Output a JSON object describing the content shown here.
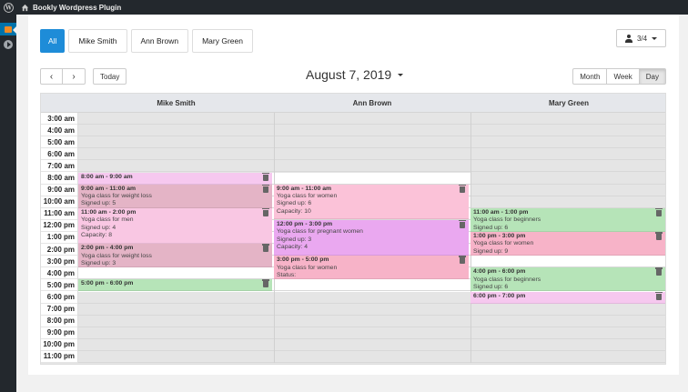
{
  "adminbar": {
    "site_title": "Bookly Wordpress Plugin",
    "wp_icon": "wordpress-logo-icon",
    "home_icon": "home-icon"
  },
  "staff_tabs": [
    {
      "label": "All",
      "active": true
    },
    {
      "label": "Mike Smith",
      "active": false
    },
    {
      "label": "Ann Brown",
      "active": false
    },
    {
      "label": "Mary Green",
      "active": false
    }
  ],
  "staff_selector": {
    "value": "3/4",
    "icon": "person-icon"
  },
  "toolbar": {
    "prev": "‹",
    "next": "›",
    "today": "Today",
    "date": "August 7, 2019"
  },
  "views": [
    {
      "label": "Month",
      "active": false
    },
    {
      "label": "Week",
      "active": false
    },
    {
      "label": "Day",
      "active": true
    }
  ],
  "columns": [
    "Mike Smith",
    "Ann Brown",
    "Mary Green"
  ],
  "times": [
    "3:00 am",
    "4:00 am",
    "5:00 am",
    "6:00 am",
    "7:00 am",
    "8:00 am",
    "9:00 am",
    "10:00 am",
    "11:00 am",
    "12:00 pm",
    "1:00 pm",
    "2:00 pm",
    "3:00 pm",
    "4:00 pm",
    "5:00 pm",
    "6:00 pm",
    "7:00 pm",
    "8:00 pm",
    "9:00 pm",
    "10:00 pm",
    "11:00 pm"
  ],
  "events": [
    {
      "col": 0,
      "start": 8,
      "end": 9,
      "color": "#f6c8ef",
      "time": "8:00 am - 9:00 am",
      "lines": []
    },
    {
      "col": 0,
      "start": 9,
      "end": 11,
      "color": "#e4b4c6",
      "time": "9:00 am - 11:00 am",
      "lines": [
        "Yoga class for weight loss",
        "Signed up: 5"
      ]
    },
    {
      "col": 0,
      "start": 11,
      "end": 14,
      "color": "#f9c7e3",
      "time": "11:00 am - 2:00 pm",
      "lines": [
        "Yoga class for men",
        "Signed up: 4",
        "Capacity: 8"
      ]
    },
    {
      "col": 0,
      "start": 14,
      "end": 16,
      "color": "#e4b4c6",
      "time": "2:00 pm - 4:00 pm",
      "lines": [
        "Yoga class for weight loss",
        "Signed up: 3"
      ]
    },
    {
      "col": 0,
      "start": 17,
      "end": 18,
      "color": "#b6e4b8",
      "time": "5:00 pm - 6:00 pm",
      "lines": []
    },
    {
      "col": 1,
      "start": 9,
      "end": 11.9,
      "color": "#fbc2d8",
      "time": "9:00 am - 11:00 am",
      "lines": [
        "Yoga class for women",
        "Signed up: 6",
        "Capacity: 10"
      ]
    },
    {
      "col": 1,
      "start": 12,
      "end": 15,
      "color": "#eaa8f0",
      "time": "12:00 pm - 3:00 pm",
      "lines": [
        "Yoga class for pregnant women",
        "Signed up: 3",
        "Capacity: 4"
      ]
    },
    {
      "col": 1,
      "start": 15,
      "end": 17,
      "color": "#f7b3c8",
      "time": "3:00 pm - 5:00 pm",
      "lines": [
        "Yoga class for women",
        "Status:"
      ]
    },
    {
      "col": 2,
      "start": 11,
      "end": 13,
      "color": "#b6e4b8",
      "time": "11:00 am - 1:00 pm",
      "lines": [
        "Yoga class for beginners",
        "Signed up: 6"
      ]
    },
    {
      "col": 2,
      "start": 13,
      "end": 15,
      "color": "#f7b3c8",
      "time": "1:00 pm - 3:00 pm",
      "lines": [
        "Yoga class for women",
        "Signed up: 9"
      ]
    },
    {
      "col": 2,
      "start": 16,
      "end": 18,
      "color": "#b6e4b8",
      "time": "4:00 pm - 6:00 pm",
      "lines": [
        "Yoga class for beginners",
        "Signed up: 6"
      ]
    },
    {
      "col": 2,
      "start": 18,
      "end": 19,
      "color": "#f6c8ef",
      "time": "6:00 pm - 7:00 pm",
      "lines": []
    }
  ],
  "working_hours": [
    {
      "col": 0,
      "start": 8,
      "end": 18
    },
    {
      "col": 1,
      "start": 8,
      "end": 18
    },
    {
      "col": 2,
      "start": 11,
      "end": 19
    }
  ]
}
